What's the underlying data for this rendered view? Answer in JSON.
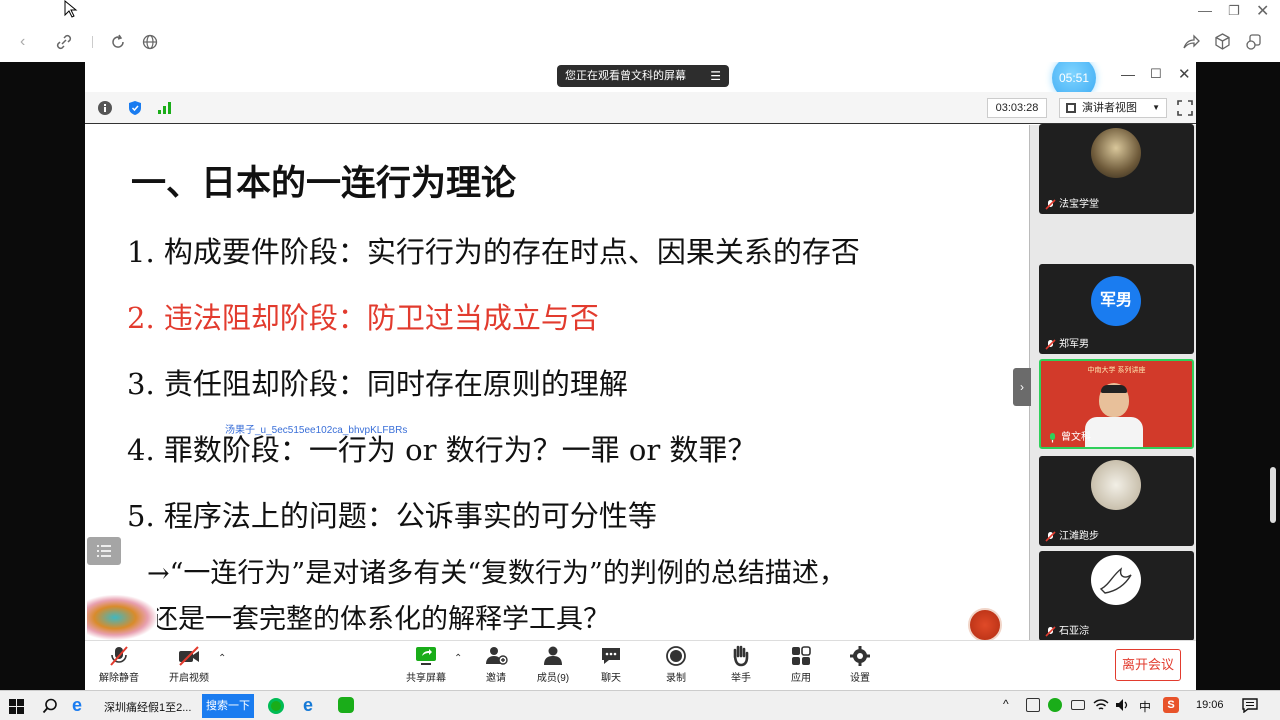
{
  "browser": {
    "icons": [
      "back-icon",
      "link-icon",
      "reload-icon",
      "globe-icon"
    ],
    "right_icons": [
      "share-icon",
      "cube-icon",
      "copy-icon"
    ]
  },
  "meeting": {
    "sharing_banner": "您正在观看曾文科的屏幕",
    "timer_bubble": "05:51",
    "elapsed": "03:03:28",
    "view_mode": "演讲者视图"
  },
  "slide": {
    "title": "一、日本的一连行为理论",
    "items": [
      {
        "text": "1. 构成要件阶段：实行行为的存在时点、因果关系的存否",
        "color": "#111111"
      },
      {
        "text": "2. 违法阻却阶段：防卫过当成立与否",
        "color": "#e23b2e"
      },
      {
        "text": "3. 责任阻却阶段：同时存在原则的理解",
        "color": "#111111"
      },
      {
        "text": "4. 罪数阶段：一行为 or 数行为？一罪 or 数罪？",
        "color": "#111111"
      },
      {
        "text": "5. 程序法上的问题：公诉事实的可分性等",
        "color": "#111111"
      }
    ],
    "arrow_line1": "→“一连行为”是对诸多有关“复数行为”的判例的总结描述，",
    "arrow_line2": "还是一套完整的体系化的解释学工具？",
    "watermark": "汤果子_u_5ec515ee102ca_bhvpKLFBRs"
  },
  "participants": [
    {
      "name": "法宝学堂"
    },
    {
      "name": "郑军男",
      "avatar_text": "军男"
    },
    {
      "name": "曾文科",
      "banner": "中南大学 系列讲座"
    },
    {
      "name": "江滩跑步"
    },
    {
      "name": "石亚淙"
    },
    {
      "name": ""
    }
  ],
  "toolbar": {
    "unmute": "解除静音",
    "start_video": "开启视频",
    "share_screen": "共享屏幕",
    "invite": "邀请",
    "members": "成员(9)",
    "chat": "聊天",
    "record": "录制",
    "raise_hand": "举手",
    "apps": "应用",
    "settings": "设置",
    "leave": "离开会议"
  },
  "taskbar": {
    "window_title": "深圳痛经假1至2...",
    "search_button": "搜索一下",
    "ime": "中",
    "clock": "19:06"
  },
  "colors": {
    "accent_blue": "#1a7cf0",
    "leave_red": "#e23b2e",
    "green": "#1aad19"
  }
}
